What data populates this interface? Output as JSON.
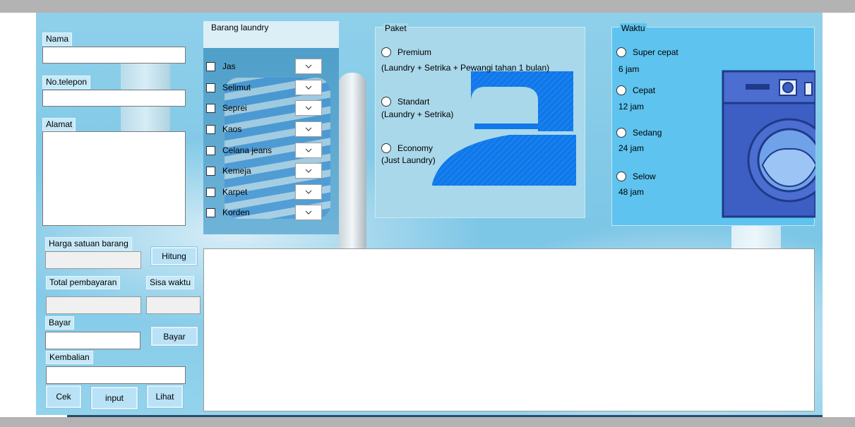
{
  "form": {
    "nama_label": "Nama",
    "telepon_label": "No.telepon",
    "alamat_label": "Alamat",
    "harga_label": "Harga satuan barang",
    "hitung_button": "Hitung",
    "total_label": "Total pembayaran",
    "sisa_label": "Sisa waktu",
    "bayar_label": "Bayar",
    "bayar_button": "Bayar",
    "kembalian_label": "Kembalian",
    "cek_button": "Cek",
    "input_button": "input",
    "lihat_button": "Lihat"
  },
  "barang": {
    "title": "Barang laundry",
    "items": [
      "Jas",
      "Selimut",
      "Seprei",
      "Kaos",
      "Celana jeans",
      "Kemeja",
      "Karpet",
      "Korden"
    ]
  },
  "paket": {
    "title": "Paket",
    "options": [
      {
        "label": "Premium",
        "note": "(Laundry + Setrika + Pewangi tahan 1 bulan)"
      },
      {
        "label": "Standart",
        "note": "(Laundry + Setrika)"
      },
      {
        "label": "Economy",
        "note": "(Just Laundry)"
      }
    ]
  },
  "waktu": {
    "title": "Waktu",
    "options": [
      {
        "label": "Super cepat",
        "note": "6 jam"
      },
      {
        "label": "Cepat",
        "note": "12 jam"
      },
      {
        "label": "Sedang",
        "note": "24 jam"
      },
      {
        "label": "Selow",
        "note": "48 jam"
      }
    ]
  },
  "icons": {
    "iron": "iron-icon",
    "washing_machine": "washing-machine-icon",
    "dropdown": "chevron-down-icon"
  },
  "colors": {
    "form_background": "#7cc6e6",
    "label_background": "#c6e9f7",
    "button_background": "#b9e2f7",
    "group_background": "#a9d8ea",
    "waktu_background": "#5ec3ef",
    "illustration_blue": "#0f78ea"
  }
}
